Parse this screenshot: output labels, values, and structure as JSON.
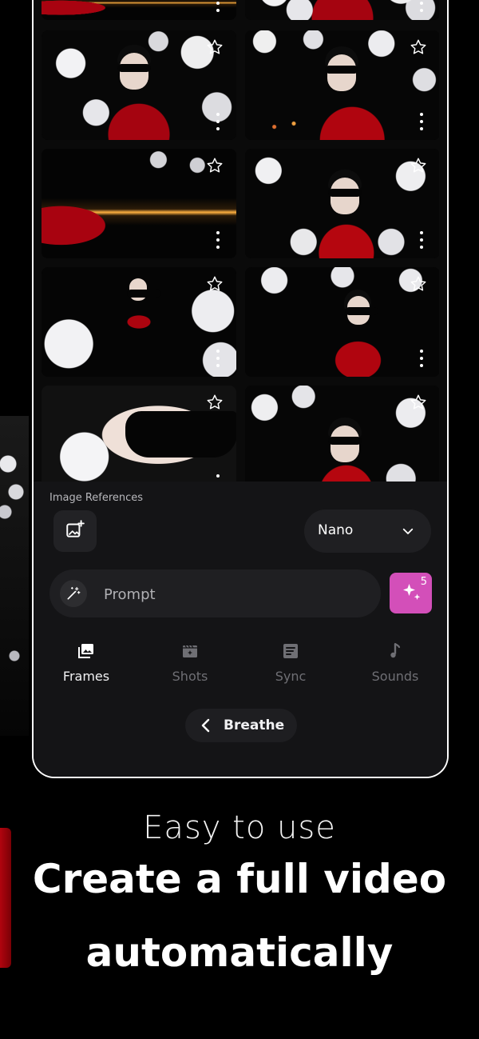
{
  "panel": {
    "image_references_label": "Image References",
    "model": {
      "selected": "Nano"
    },
    "prompt": {
      "placeholder": "Prompt"
    },
    "generate": {
      "credits": "5"
    },
    "nav": {
      "items": [
        {
          "label": "Frames",
          "icon": "image-gallery-icon",
          "active": true
        },
        {
          "label": "Shots",
          "icon": "clapperboard-sparkle-icon",
          "active": false
        },
        {
          "label": "Sync",
          "icon": "script-icon",
          "active": false
        },
        {
          "label": "Sounds",
          "icon": "music-note-icon",
          "active": false
        }
      ]
    },
    "back_button": {
      "label": "Breathe"
    }
  },
  "caption": {
    "subtitle": "Easy to use",
    "headline_line1": "Create a full video",
    "headline_line2": "automatically"
  },
  "colors": {
    "background": "#000000",
    "panel": "#141416",
    "generate_button": "#d34fb9",
    "inactive_text": "#6f6f74"
  }
}
